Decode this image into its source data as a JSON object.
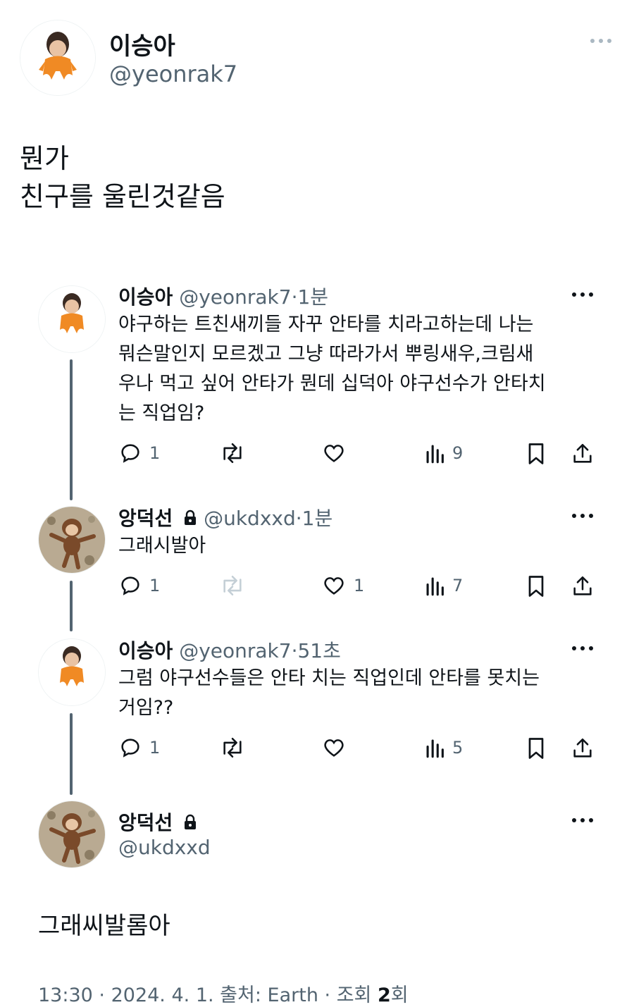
{
  "main_post": {
    "display_name": "이승아",
    "handle": "@yeonrak7",
    "more_icon": "more-horizontal-icon",
    "text_lines": [
      "뭔가",
      "친구를 울린것같음"
    ]
  },
  "thread": [
    {
      "display_name": "이승아",
      "handle": "@yeonrak7",
      "separator": "·",
      "time": "1분",
      "text_lines": [
        "야구하는 트친새끼들 자꾸 안타를 치라고하는데 나는",
        "뭐슨말인지 모르겠고 그냥 따라가서 뿌링새우,크림새",
        "우나 먹고 싶어 안타가 뭔데 십덕아 야구선수가 안타치",
        "는 직업임?"
      ],
      "locked": false,
      "counts": {
        "reply": "1",
        "retweet": "",
        "like": "",
        "views": "9"
      },
      "retweet_enabled": true
    },
    {
      "display_name": "앙덕선",
      "handle": "@ukdxxd",
      "separator": "·",
      "time": "1분",
      "text_lines": [
        "그래시발아"
      ],
      "locked": true,
      "counts": {
        "reply": "1",
        "retweet": "",
        "like": "1",
        "views": "7"
      },
      "retweet_enabled": false
    },
    {
      "display_name": "이승아",
      "handle": "@yeonrak7",
      "separator": "·",
      "time": "51초",
      "text_lines": [
        "그럼 야구선수들은 안타 치는 직업인데 안타를 못치는",
        "거임??"
      ],
      "locked": false,
      "counts": {
        "reply": "1",
        "retweet": "",
        "like": "",
        "views": "5"
      },
      "retweet_enabled": true
    }
  ],
  "focused_post": {
    "display_name": "앙덕선",
    "handle": "@ukdxxd",
    "locked": true,
    "text": "그래씨발롬아"
  },
  "footer": {
    "time": "13:30",
    "sep1": "·",
    "date": "2024. 4. 1.",
    "source_label": "출처: Earth",
    "sep2": "·",
    "views_label": "조회",
    "views_count": "2",
    "views_unit": "회"
  },
  "colors": {
    "text": "#0f1419",
    "muted": "#536471",
    "thread_line": "#536471",
    "orange": "#f08a24",
    "monkey_brown": "#7a4a2a"
  }
}
